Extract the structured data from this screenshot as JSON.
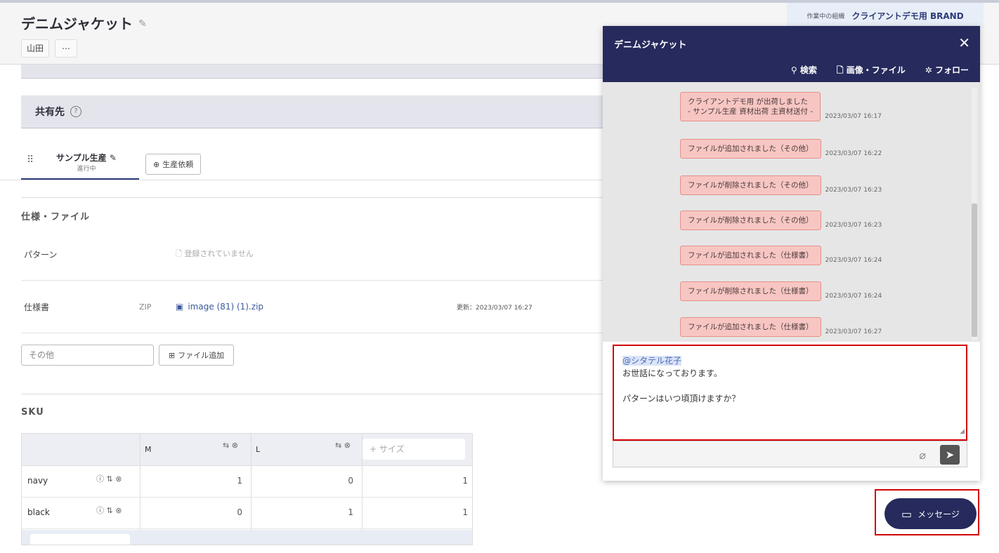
{
  "header": {
    "title": "デニムジャケット",
    "chips": [
      "山田",
      "⋯"
    ]
  },
  "org": {
    "label": "作業中の組織",
    "name": "クライアントデモ用 BRAND"
  },
  "share": {
    "title": "共有先"
  },
  "tabs": {
    "active_name": "サンプル生産",
    "active_status": "進行中",
    "production_request": "生産依頼"
  },
  "spec": {
    "title": "仕様・ファイル",
    "rows": [
      {
        "label": "パターン",
        "empty": "登録されていません"
      },
      {
        "label": "仕様書",
        "type": "ZIP",
        "file": "image (81) (1).zip",
        "date": "更新：2023/03/07 16:27"
      }
    ],
    "other_placeholder": "その他",
    "add_file": "ファイル追加"
  },
  "sku": {
    "title": "SKU",
    "columns": [
      "M",
      "L"
    ],
    "add_size": "+ サイズ",
    "rows": [
      {
        "name": "navy",
        "values": [
          "1",
          "0",
          "1"
        ]
      },
      {
        "name": "black",
        "values": [
          "0",
          "1",
          "1"
        ]
      }
    ]
  },
  "chat": {
    "title": "デニムジャケット",
    "close": "✕",
    "actions": [
      "検索",
      "画像・ファイル",
      "フォロー"
    ],
    "messages": [
      {
        "text": "クライアントデモ用 が出荷しました",
        "text2": "- サンプル生産 資材出荷 主資材送付 -",
        "time": "2023/03/07 16:17"
      },
      {
        "text": "ファイルが追加されました（その他）",
        "time": "2023/03/07 16:22"
      },
      {
        "text": "ファイルが削除されました（その他）",
        "time": "2023/03/07 16:23"
      },
      {
        "text": "ファイルが削除されました（その他）",
        "time": "2023/03/07 16:23"
      },
      {
        "text": "ファイルが追加されました（仕様書）",
        "time": "2023/03/07 16:24"
      },
      {
        "text": "ファイルが削除されました（仕様書）",
        "time": "2023/03/07 16:24"
      },
      {
        "text": "ファイルが追加されました（仕様書）",
        "time": "2023/03/07 16:27"
      }
    ],
    "compose": {
      "mention": "@シタテル花子",
      "line1": "お世話になっております。",
      "line2": "パターンはいつ頃頂けますか？"
    }
  },
  "message_button": {
    "label": "メッセージ"
  }
}
